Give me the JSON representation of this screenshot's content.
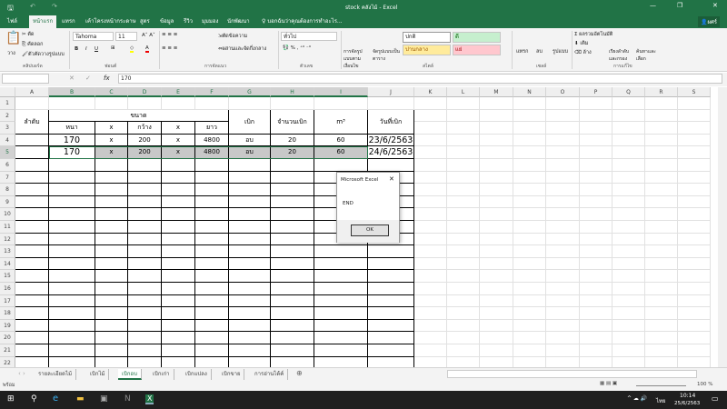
{
  "window": {
    "title": "stock คลังไม้ - Excel",
    "user": "ผศร์"
  },
  "quick_access": {
    "save": "save-icon",
    "undo": "undo-icon",
    "redo": "redo-icon"
  },
  "tabs": [
    "ไฟล์",
    "หน้าแรก",
    "แทรก",
    "เค้าโครงหน้ากระดาษ",
    "สูตร",
    "ข้อมูล",
    "รีวิว",
    "มุมมอง",
    "นักพัฒนา"
  ],
  "tell_me": "บอกฉันว่าคุณต้องการทำอะไร...",
  "ribbon": {
    "clipboard": {
      "paste": "วาง",
      "cut": "ตัด",
      "copy": "คัดลอก",
      "format_painter": "ตัวคัดวางรูปแบบ",
      "group": "คลิปบอร์ด"
    },
    "font": {
      "name": "Tahoma",
      "size": "11",
      "group": "ฟอนต์"
    },
    "alignment": {
      "wrap": "ตัดข้อความ",
      "merge": "ผสานและจัดกึ่งกลาง",
      "group": "การจัดแนว"
    },
    "number": {
      "format": "ทั่วไป",
      "group": "ตัวเลข"
    },
    "styles": {
      "conditional": "การจัดรูปแบบตามเงื่อนไข",
      "format_table": "จัดรูปแบบเป็นตาราง",
      "normal": "ปกติ",
      "good": "ดี",
      "neutral": "ปานกลาง",
      "bad": "แย่",
      "group": "สไตล์"
    },
    "cells": {
      "insert": "แทรก",
      "delete": "ลบ",
      "format": "รูปแบบ",
      "group": "เซลล์"
    },
    "editing": {
      "autosum": "ผลรวมอัตโนมัติ",
      "fill": "เติม",
      "clear": "ล้าง",
      "sort": "เรียงลำดับและกรอง",
      "find": "ค้นหาและเลือก",
      "group": "การแก้ไข"
    }
  },
  "formula_bar": {
    "name_box": "",
    "value": "170",
    "fx": "fx"
  },
  "columns": [
    "A",
    "B",
    "C",
    "D",
    "E",
    "F",
    "G",
    "H",
    "I",
    "J",
    "K",
    "L",
    "M",
    "N",
    "O",
    "P",
    "Q",
    "R",
    "S"
  ],
  "rows": [
    "1",
    "2",
    "3",
    "4",
    "5",
    "6",
    "7",
    "8",
    "9",
    "10",
    "11",
    "12",
    "13",
    "14",
    "15",
    "16",
    "17",
    "18",
    "19",
    "20",
    "21",
    "22"
  ],
  "table": {
    "headers": {
      "order": "ลำดับ",
      "size": "ขนาด",
      "issue": "เบิก",
      "qty": "จำนวนเบิก",
      "m3": "m³",
      "date": "วันที่เบิก"
    },
    "subheaders": [
      "หนา",
      "x",
      "กว้าง",
      "x",
      "ยาว"
    ],
    "rows": [
      [
        "",
        "170",
        "x",
        "200",
        "x",
        "4800",
        "อบ",
        "20",
        "60",
        "23/6/2563"
      ],
      [
        "",
        "170",
        "x",
        "200",
        "x",
        "4800",
        "อบ",
        "20",
        "60",
        "24/6/2563"
      ]
    ]
  },
  "dialog": {
    "title": "Microsoft Excel",
    "message": "END",
    "ok": "OK"
  },
  "sheets": [
    "รายละเอียดไม้",
    "เบิกไม้",
    "เบิกอบ",
    "เบิกเก่า",
    "เบิกแปลง",
    "เบิกขาย",
    "การอ่านได้ค์"
  ],
  "active_sheet": "เบิกอบ",
  "status": {
    "mode": "พร้อม",
    "zoom": "100 %"
  },
  "taskbar": {
    "time": "10:14",
    "date": "25/6/2563",
    "lang": "ไทย"
  },
  "colors": {
    "excel_green": "#217346",
    "selection": "#c8c8c8"
  }
}
